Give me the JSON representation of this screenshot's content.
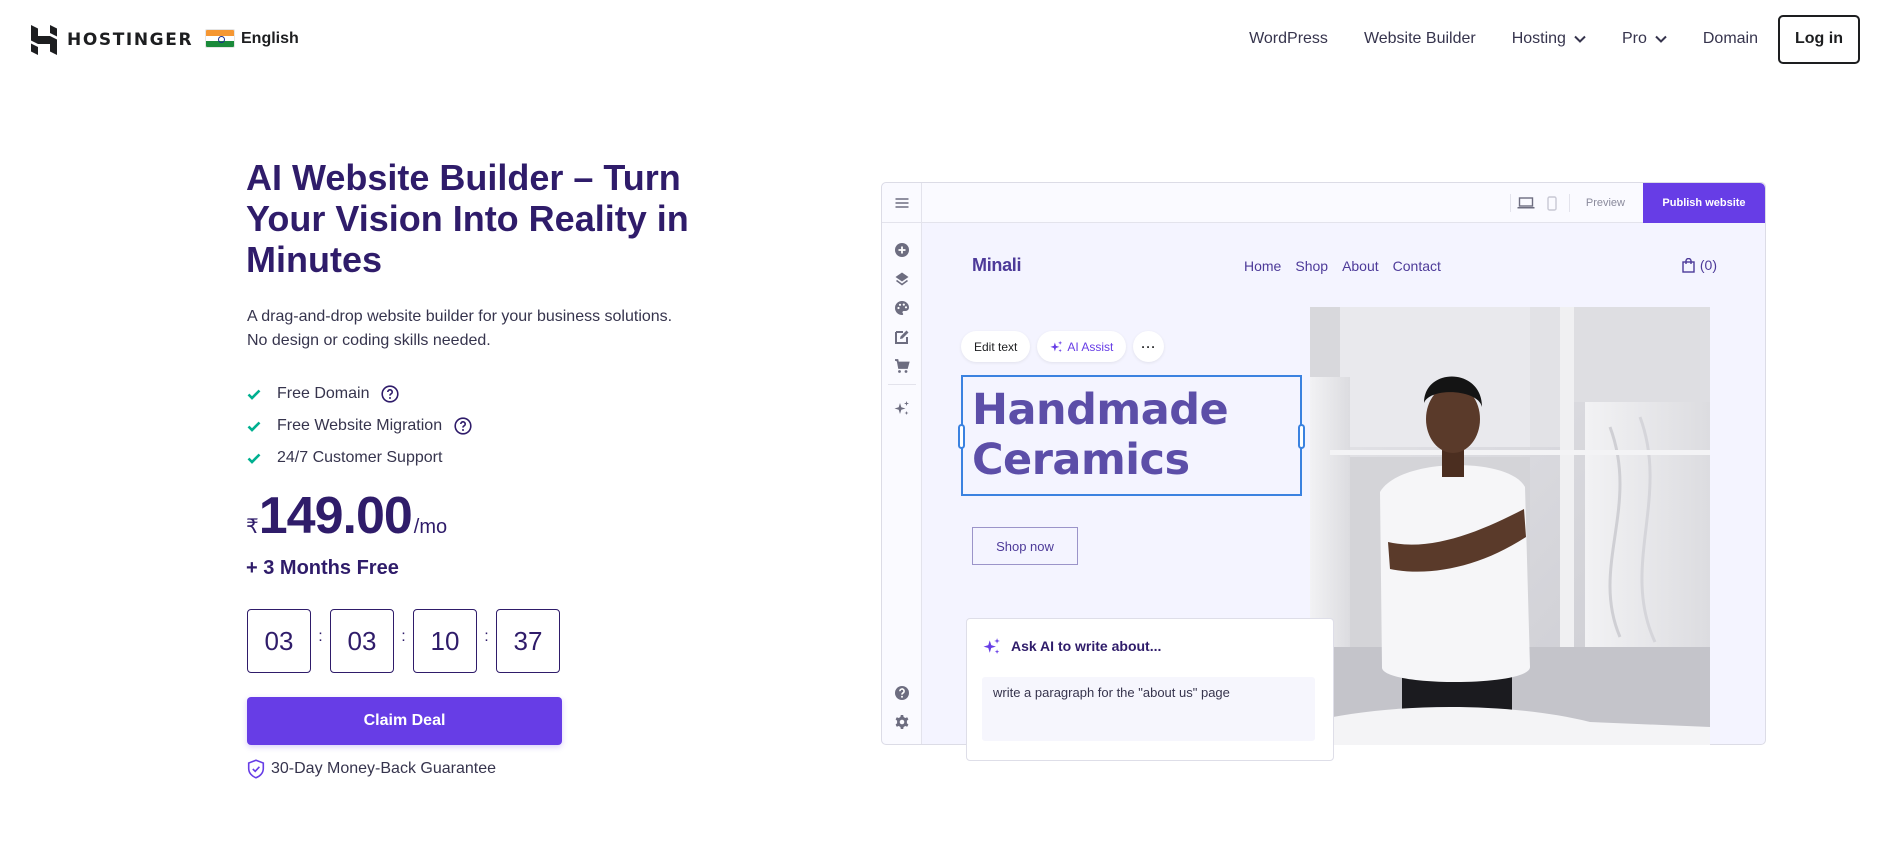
{
  "header": {
    "brand": "HOSTINGER",
    "language": {
      "flag": "india-flag",
      "label": "English"
    },
    "nav": [
      {
        "label": "WordPress",
        "dropdown": false
      },
      {
        "label": "Website Builder",
        "dropdown": false
      },
      {
        "label": "Hosting",
        "dropdown": true
      },
      {
        "label": "Pro",
        "dropdown": true
      },
      {
        "label": "Domain",
        "dropdown": false
      }
    ],
    "login_label": "Log in"
  },
  "hero": {
    "title": "AI Website Builder – Turn Your Vision Into Reality in Minutes",
    "subtitle_line1": "A drag-and-drop website builder for your business solutions.",
    "subtitle_line2": "No design or coding skills needed.",
    "features": [
      {
        "label": "Free Domain",
        "has_help": true
      },
      {
        "label": "Free Website Migration",
        "has_help": true
      },
      {
        "label": "24/7 Customer Support",
        "has_help": false
      }
    ],
    "price": {
      "currency": "₹",
      "amount": "149.00",
      "period": "/mo"
    },
    "bonus": "+ 3 Months Free",
    "countdown": [
      "03",
      "03",
      "10",
      "37"
    ],
    "countdown_separator": ":",
    "cta_label": "Claim Deal",
    "guarantee": "30-Day Money-Back Guarantee"
  },
  "builder": {
    "topbar": {
      "preview_label": "Preview",
      "publish_label": "Publish website"
    },
    "sidebar_tools": [
      "add-icon",
      "layers-icon",
      "palette-icon",
      "edit-icon",
      "cart-icon",
      "ai-sparkle-icon"
    ],
    "sidebar_bottom": [
      "help-icon",
      "settings-icon"
    ],
    "site": {
      "logo": "Minali",
      "nav": [
        "Home",
        "Shop",
        "About",
        "Contact"
      ],
      "cart_count": "(0)",
      "toolbar": {
        "edit_label": "Edit text",
        "ai_label": "AI Assist",
        "more_label": "···"
      },
      "heading_line1": "Handmade",
      "heading_line2": "Ceramics",
      "shop_button": "Shop now"
    },
    "ai_card": {
      "title": "Ask AI to write about...",
      "prompt": "write a paragraph for the \"about us\" page"
    }
  },
  "colors": {
    "primary": "#673de6",
    "heading": "#2f1c6a",
    "check": "#00b090",
    "selection": "#3b82e0",
    "site_accent": "#5c4ea8"
  }
}
